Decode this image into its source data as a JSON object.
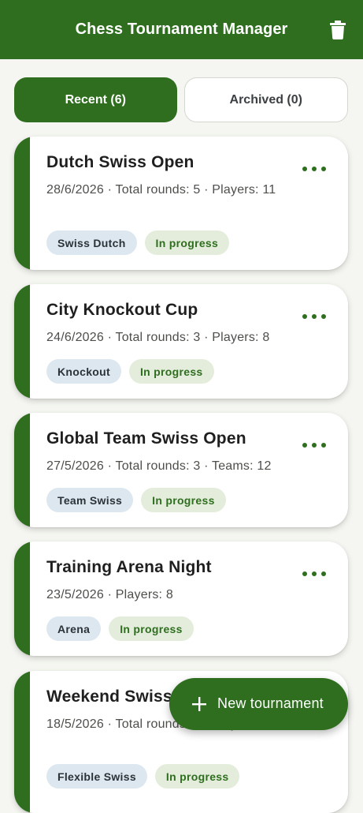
{
  "appbar": {
    "title": "Chess Tournament Manager",
    "delete_icon": "trash-icon"
  },
  "tabs": [
    {
      "label": "Recent (6)",
      "active": true
    },
    {
      "label": "Archived (0)",
      "active": false
    }
  ],
  "tournaments": [
    {
      "title": "Dutch Swiss Open",
      "meta": "28/6/2026 · Total rounds: 5 · Players: 11",
      "type": "Swiss Dutch",
      "status": "In progress"
    },
    {
      "title": "City Knockout Cup",
      "meta": "24/6/2026 · Total rounds: 3 · Players: 8",
      "type": "Knockout",
      "status": "In progress"
    },
    {
      "title": "Global Team Swiss Open",
      "meta": "27/5/2026 · Total rounds: 3 · Teams: 12",
      "type": "Team Swiss",
      "status": "In progress"
    },
    {
      "title": "Training Arena Night",
      "meta": "23/5/2026 · Players: 8",
      "type": "Arena",
      "status": "In progress"
    },
    {
      "title": "Weekend Swiss",
      "meta": "18/5/2026 · Total rounds: 4 · Players: 12",
      "type": "Flexible Swiss",
      "status": "In progress"
    }
  ],
  "fab": {
    "label": "New tournament",
    "icon": "plus-icon"
  },
  "colors": {
    "primary": "#2f6e1f",
    "background": "#f5f6f1",
    "type_chip": "#dde7f0",
    "status_chip": "#e4eddc"
  }
}
